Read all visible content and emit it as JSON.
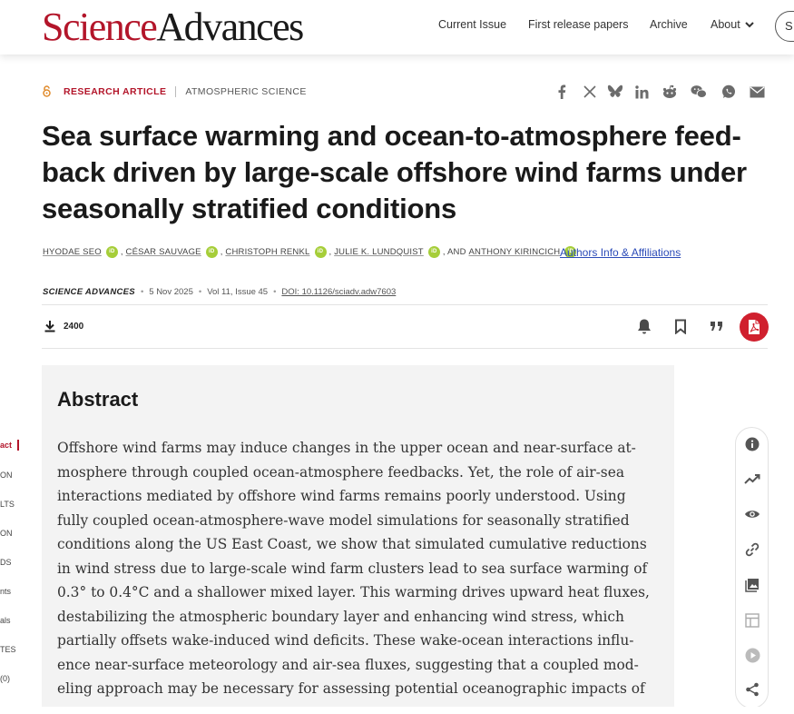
{
  "header": {
    "logo_science": "Science",
    "logo_advances": "Advances",
    "nav": {
      "current_issue": "Current Issue",
      "first_release": "First release papers",
      "archive": "Archive",
      "about": "About",
      "search_pill": "S"
    }
  },
  "article": {
    "type": "RESEARCH ARTICLE",
    "subject": "ATMOSPHERIC SCIENCE",
    "title": "Sea surface warming and ocean-to-atmosphere feed-back driven by large-scale offshore wind farms under seasonally stratified conditions",
    "authors": [
      {
        "name": "HYODAE SEO"
      },
      {
        "name": "CÉSAR SAUVAGE"
      },
      {
        "name": "CHRISTOPH RENKL"
      },
      {
        "name": "JULIE K. LUNDQUIST"
      },
      {
        "name": "ANTHONY KIRINCICH"
      }
    ],
    "and_text": ", AND",
    "comma": ",",
    "orcid_label": "iD",
    "authors_info_link": "Authors Info & Affiliations",
    "journal": "SCIENCE ADVANCES",
    "date": "5 Nov 2025",
    "volume_issue": "Vol 11, Issue 45",
    "doi": "DOI: 10.1126/sciadv.adw7603",
    "downloads": "2400",
    "dot": "•"
  },
  "abstract": {
    "heading": "Abstract",
    "text": "Offshore wind farms may induce changes in the upper ocean and near-surface at-mosphere through coupled ocean-atmosphere feedbacks. Yet, the role of air-sea interactions mediated by offshore wind farms remains poorly understood. Using fully coupled ocean-atmosphere-wave model simulations for seasonally stratified conditions along the US East Coast, we show that simulated cumulative reductions in wind stress due to large-scale wind farm clusters lead to sea surface warming of 0.3° to 0.4°C and a shallower mixed layer. This warming drives upward heat fluxes, destabilizing the atmospheric boundary layer and enhancing wind stress, which partially offsets wake-induced wind deficits. These wake-ocean interactions influ-ence near-surface meteorology and air-sea fluxes, suggesting that a coupled mod-eling approach may be necessary for assessing potential oceanographic impacts of"
  },
  "toc": {
    "items": [
      "act",
      "ON",
      "LTS",
      "ON",
      "DS",
      "nts",
      "als",
      "TES",
      "(0)"
    ]
  },
  "colors": {
    "brand_red": "#b3152a",
    "pdf_red": "#d0202e",
    "link_blue": "#2b4bb8",
    "orcid_green": "#a6ce39"
  }
}
